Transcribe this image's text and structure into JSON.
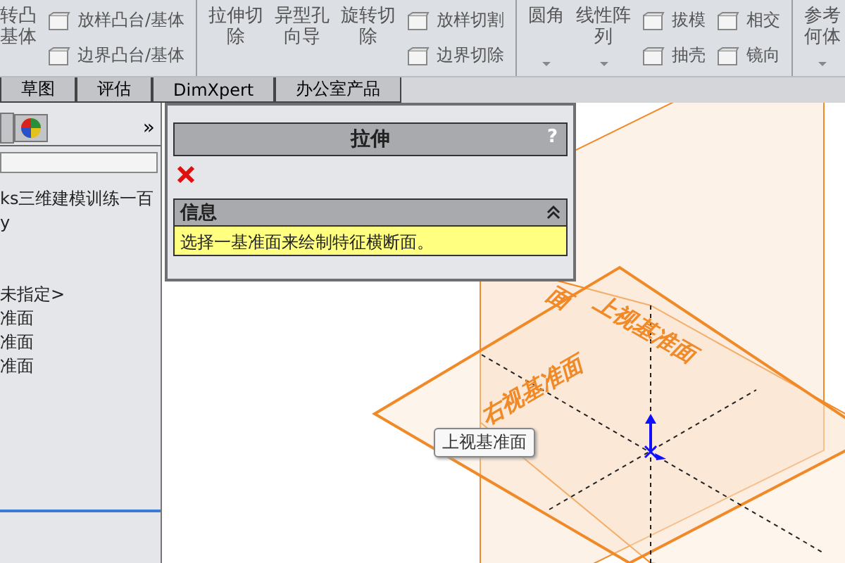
{
  "toolbar": {
    "groups": [
      {
        "items": [
          {
            "kind": "large",
            "lines": [
              "转凸",
              "基体"
            ],
            "has_menu": false
          },
          {
            "kind": "stack",
            "entries": [
              "放样凸台/基体",
              "边界凸台/基体"
            ]
          }
        ]
      },
      {
        "items": [
          {
            "kind": "large",
            "lines": [
              "拉伸切",
              "除"
            ],
            "has_menu": false
          },
          {
            "kind": "large",
            "lines": [
              "异型孔",
              "向导"
            ],
            "has_menu": false
          },
          {
            "kind": "large",
            "lines": [
              "旋转切",
              "除"
            ],
            "has_menu": false
          },
          {
            "kind": "stack",
            "entries": [
              "放样切割",
              "边界切除"
            ]
          }
        ]
      },
      {
        "items": [
          {
            "kind": "large",
            "lines": [
              "圆角"
            ],
            "has_menu": true
          },
          {
            "kind": "large",
            "lines": [
              "线性阵",
              "列"
            ],
            "has_menu": true
          },
          {
            "kind": "stack",
            "entries": [
              "拔模",
              "抽壳"
            ]
          },
          {
            "kind": "stack",
            "entries": [
              "相交",
              "镜向"
            ]
          }
        ]
      },
      {
        "items": [
          {
            "kind": "large",
            "lines": [
              "参考",
              "何体"
            ],
            "has_menu": true
          }
        ]
      }
    ]
  },
  "tabs": [
    {
      "label": "草图",
      "selected": false
    },
    {
      "label": "评估",
      "selected": false
    },
    {
      "label": "DimXpert",
      "selected": false
    },
    {
      "label": "办公室产品",
      "selected": false
    }
  ],
  "left_panel": {
    "more": "»",
    "tree": [
      {
        "label": "ks三维建模训练一百"
      },
      {
        "label": "y"
      },
      {
        "label": "未指定>"
      },
      {
        "label": "准面"
      },
      {
        "label": "准面"
      },
      {
        "label": "准面"
      }
    ]
  },
  "property_manager": {
    "title": "拉伸",
    "help": "?",
    "message_group": {
      "title": "信息",
      "expanded": true,
      "text": "选择一基准面来绘制特征横断面。"
    }
  },
  "viewport": {
    "plane_labels": [
      {
        "text": "面",
        "kind": "front"
      },
      {
        "text": "上视基准面",
        "kind": "top"
      },
      {
        "text": "右视基准面",
        "kind": "right"
      }
    ],
    "tooltip": "上视基准面"
  }
}
